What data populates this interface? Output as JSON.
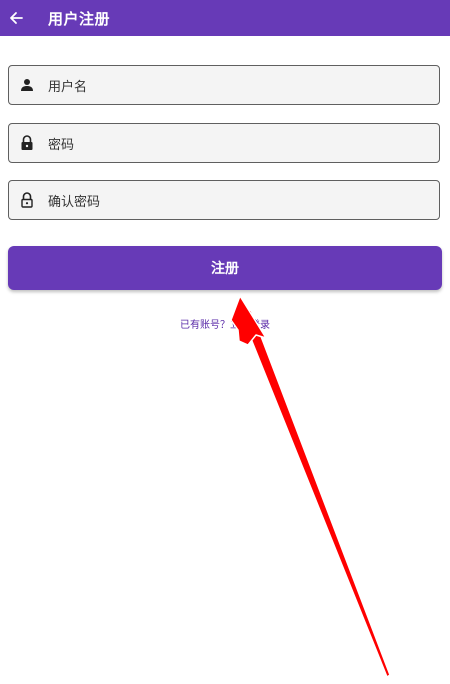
{
  "appbar": {
    "title": "用户注册",
    "back_icon": "arrow-left-icon",
    "color": "#673ab7"
  },
  "form": {
    "username_placeholder": "用户名",
    "username_icon": "person-icon",
    "password_placeholder": "密码",
    "password_icon": "lock-closed-icon",
    "confirm_placeholder": "确认密码",
    "confirm_icon": "lock-open-icon"
  },
  "register_button": {
    "label": "注册",
    "color": "#673ab7"
  },
  "login_link": {
    "text": "已有账号？立即登录",
    "color": "#5a2aa8"
  },
  "annotation": {
    "type": "red-arrow",
    "color": "#ff0000"
  }
}
